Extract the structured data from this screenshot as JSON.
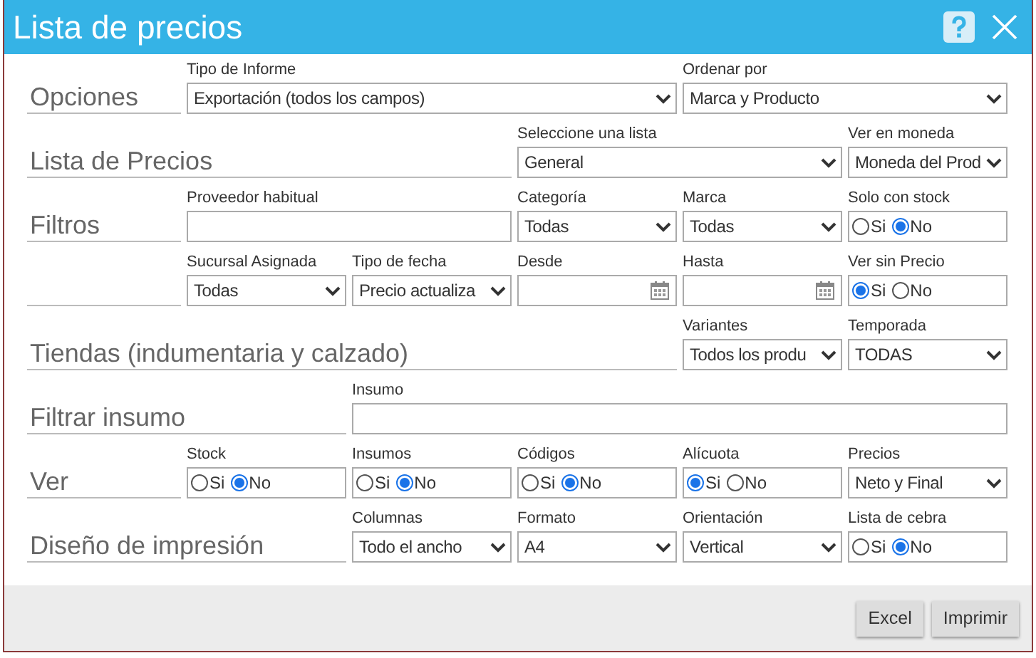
{
  "window": {
    "title": "Lista de precios"
  },
  "rows": [
    {
      "section": "Opciones",
      "fields": [
        {
          "kind": "select",
          "label": "Tipo de Informe",
          "value": "Exportación (todos los campos)"
        },
        {
          "kind": "select",
          "label": "Ordenar por",
          "value": "Marca y Producto"
        }
      ]
    },
    {
      "section": "Lista de Precios",
      "fields": [
        {
          "kind": "select",
          "label": "Seleccione una lista",
          "value": "General"
        },
        {
          "kind": "select",
          "label": "Ver en moneda",
          "value": "Moneda del Prod"
        }
      ]
    },
    {
      "section": "Filtros",
      "fields": [
        {
          "kind": "text",
          "label": "Proveedor habitual"
        },
        {
          "kind": "select",
          "label": "Categoría",
          "value": "Todas"
        },
        {
          "kind": "select",
          "label": "Marca",
          "value": "Todas"
        },
        {
          "kind": "radio",
          "label": "Solo con stock",
          "options": [
            {
              "label": "Si",
              "selected": false
            },
            {
              "label": "No",
              "selected": true
            }
          ]
        }
      ]
    },
    {
      "fields": [
        {
          "kind": "select",
          "label": "Sucursal Asignada",
          "value": "Todas"
        },
        {
          "kind": "select",
          "label": "Tipo de fecha",
          "value": "Precio actualiza"
        },
        {
          "kind": "date",
          "label": "Desde"
        },
        {
          "kind": "date",
          "label": "Hasta"
        },
        {
          "kind": "radio",
          "label": "Ver sin Precio",
          "options": [
            {
              "label": "Si",
              "selected": true
            },
            {
              "label": "No",
              "selected": false
            }
          ]
        }
      ]
    },
    {
      "section": "Tiendas (indumentaria y calzado)",
      "fields": [
        {
          "kind": "select",
          "label": "Variantes",
          "value": "Todos los produ"
        },
        {
          "kind": "select",
          "label": "Temporada",
          "value": "TODAS"
        }
      ]
    },
    {
      "section": "Filtrar insumo",
      "fields": [
        {
          "kind": "text",
          "label": "Insumo"
        }
      ]
    },
    {
      "section": "Ver",
      "fields": [
        {
          "kind": "radio",
          "label": "Stock",
          "options": [
            {
              "label": "Si",
              "selected": false
            },
            {
              "label": "No",
              "selected": true
            }
          ]
        },
        {
          "kind": "radio",
          "label": "Insumos",
          "options": [
            {
              "label": "Si",
              "selected": false
            },
            {
              "label": "No",
              "selected": true
            }
          ]
        },
        {
          "kind": "radio",
          "label": "Códigos",
          "options": [
            {
              "label": "Si",
              "selected": false
            },
            {
              "label": "No",
              "selected": true
            }
          ]
        },
        {
          "kind": "radio",
          "label": "Alícuota",
          "options": [
            {
              "label": "Si",
              "selected": true
            },
            {
              "label": "No",
              "selected": false
            }
          ]
        },
        {
          "kind": "select",
          "label": "Precios",
          "value": "Neto y Final"
        }
      ]
    },
    {
      "section": "Diseño de impresión",
      "fields": [
        {
          "kind": "select",
          "label": "Columnas",
          "value": "Todo el ancho"
        },
        {
          "kind": "select",
          "label": "Formato",
          "value": "A4"
        },
        {
          "kind": "select",
          "label": "Orientación",
          "value": "Vertical"
        },
        {
          "kind": "radio",
          "label": "Lista de cebra",
          "options": [
            {
              "label": "Si",
              "selected": false
            },
            {
              "label": "No",
              "selected": true
            }
          ]
        }
      ]
    }
  ],
  "buttons": [
    "Excel",
    "Imprimir"
  ]
}
